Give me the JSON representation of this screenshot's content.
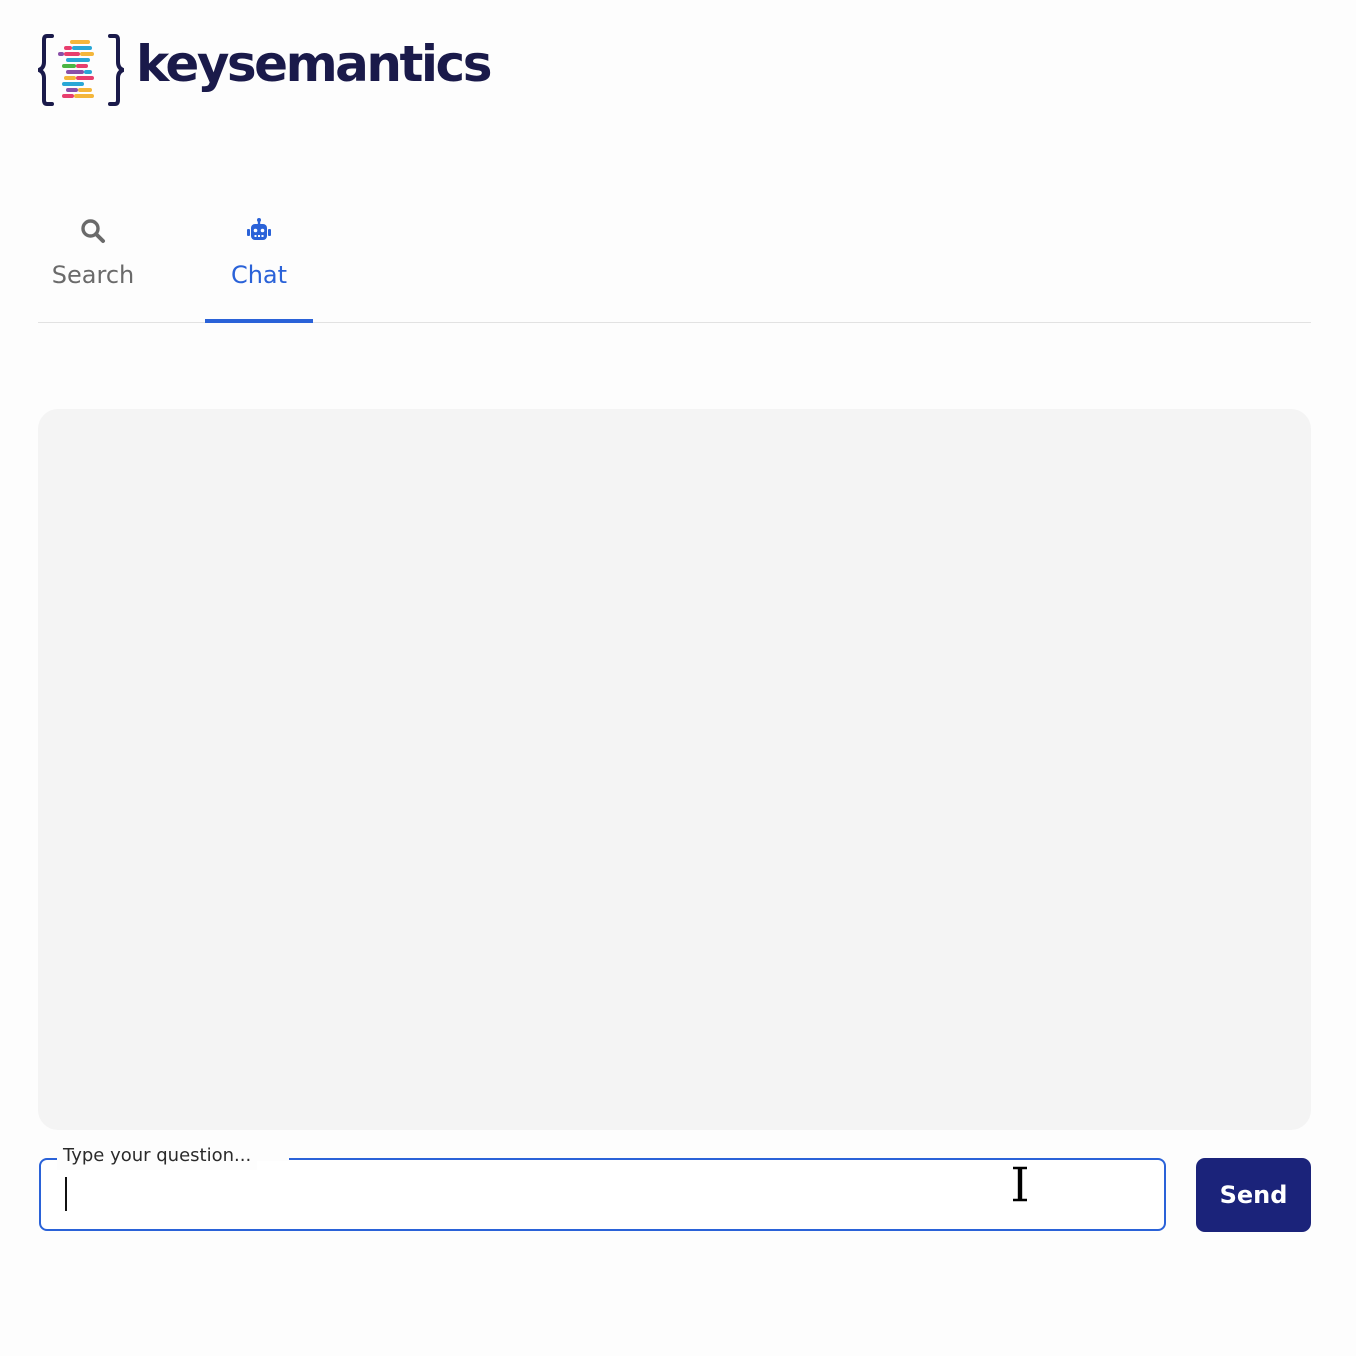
{
  "brand": {
    "name": "keysemantics",
    "text_color": "#1a1a4a",
    "icon": "braces-logo-icon"
  },
  "tabs": [
    {
      "label": "Search",
      "icon": "search-icon",
      "active": false
    },
    {
      "label": "Chat",
      "icon": "robot-icon",
      "active": true
    }
  ],
  "colors": {
    "accent": "#2a62d8",
    "send_button": "#1b237a",
    "chat_background": "#f4f4f4",
    "inactive_tab": "#6a6a6a"
  },
  "chat": {
    "messages": []
  },
  "composer": {
    "label": "Type your question...",
    "value": "",
    "send_label": "Send"
  }
}
